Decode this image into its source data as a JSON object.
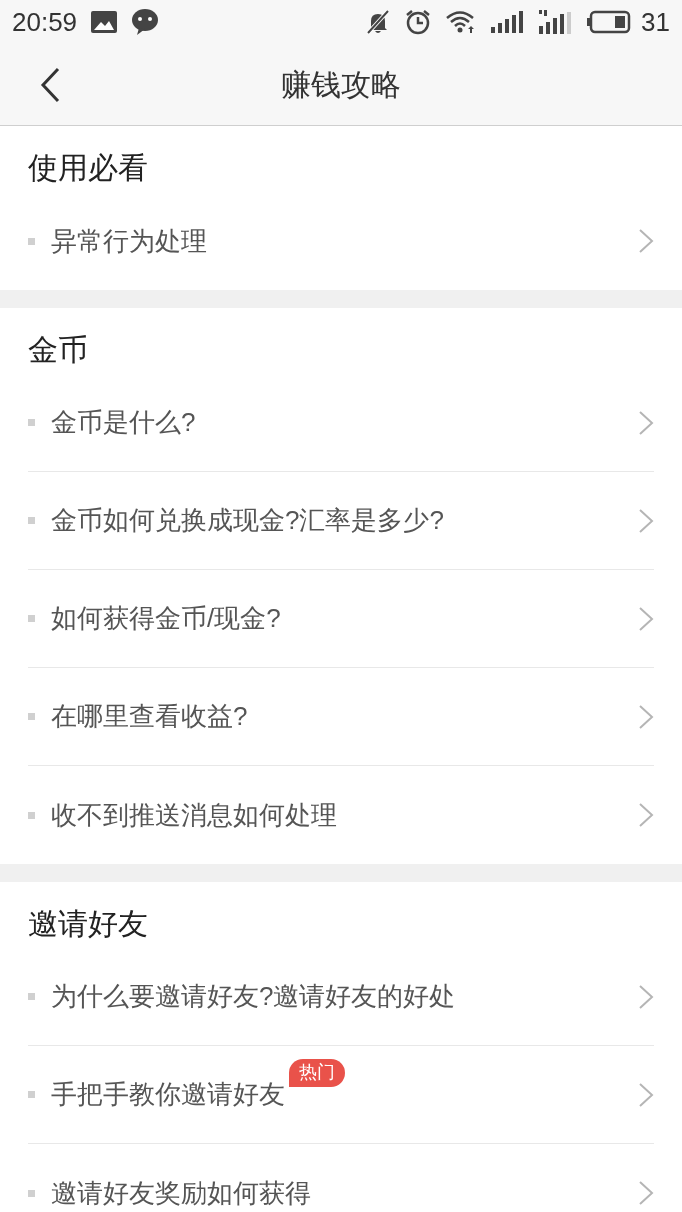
{
  "status_bar": {
    "time": "20:59",
    "battery": "31"
  },
  "header": {
    "title": "赚钱攻略"
  },
  "sections": [
    {
      "title": "使用必看",
      "items": [
        {
          "text": "异常行为处理"
        }
      ]
    },
    {
      "title": "金币",
      "items": [
        {
          "text": "金币是什么?"
        },
        {
          "text": "金币如何兑换成现金?汇率是多少?"
        },
        {
          "text": "如何获得金币/现金?"
        },
        {
          "text": "在哪里查看收益?"
        },
        {
          "text": "收不到推送消息如何处理"
        }
      ]
    },
    {
      "title": "邀请好友",
      "items": [
        {
          "text": "为什么要邀请好友?邀请好友的好处"
        },
        {
          "text": "手把手教你邀请好友",
          "badge": "热门"
        },
        {
          "text": "邀请好友奖励如何获得"
        }
      ]
    }
  ]
}
